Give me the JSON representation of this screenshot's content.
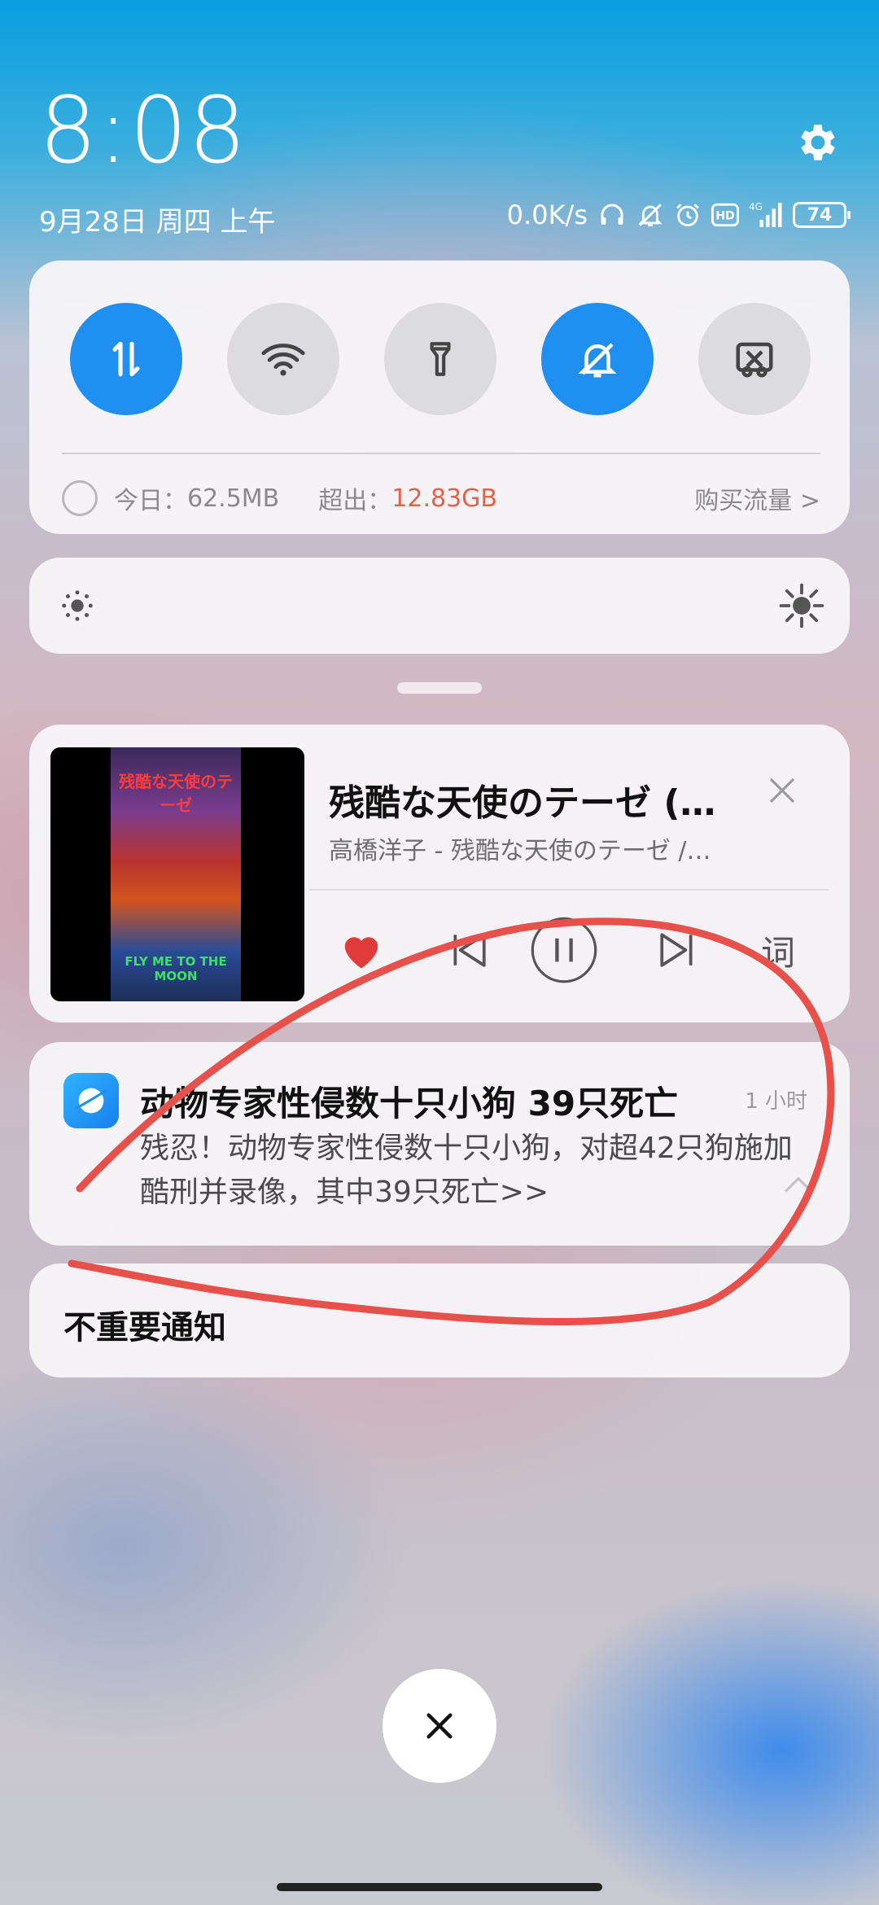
{
  "status": {
    "time": "8:08",
    "date": "9月28日 周四 上午",
    "net_speed": "0.0K/s",
    "network": "4G",
    "battery": "74"
  },
  "quick_settings": {
    "toggles": [
      {
        "icon": "mobile-data-icon",
        "state": "on"
      },
      {
        "icon": "wifi-icon",
        "state": "off"
      },
      {
        "icon": "flashlight-icon",
        "state": "off"
      },
      {
        "icon": "mute-bell-icon",
        "state": "on"
      },
      {
        "icon": "screenshot-icon",
        "state": "off"
      }
    ],
    "today_label": "今日：",
    "today_value": "62.5MB",
    "over_label": "超出：",
    "over_value": "12.83GB",
    "buy_label": "购买流量 >"
  },
  "media": {
    "title": "残酷な天使のテーゼ (…",
    "artist": "高橋洋子 - 残酷な天使のテーゼ /…",
    "cover_title": "残酷な天使のテーゼ",
    "cover_subtitle": "FLY ME TO THE MOON",
    "lyrics_label": "词",
    "liked": true
  },
  "notification": {
    "title": "动物专家性侵数十只小狗 39只死亡",
    "time": "1 小时",
    "body": "残忍！动物专家性侵数十只小狗，对超42只狗施加酷刑并录像，其中39只死亡>>"
  },
  "minor_notifications": {
    "label": "不重要通知"
  },
  "colors": {
    "accent": "#1f8ff2",
    "over_value": "#e8604a",
    "annotation": "#e8504c",
    "heart": "#e23b3b"
  }
}
